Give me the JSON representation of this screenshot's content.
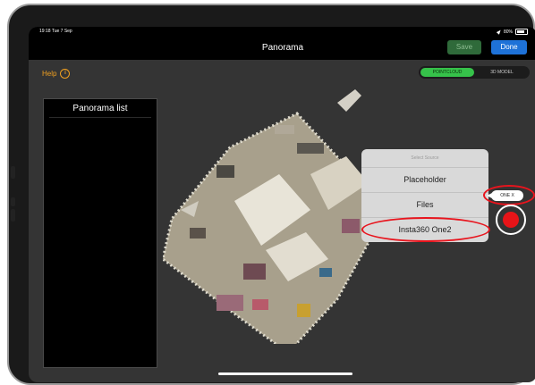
{
  "status_bar": {
    "time": "19:18",
    "date": "Tue 7 Sep",
    "battery": "80%",
    "location_icon": "location-arrow-icon",
    "battery_icon": "battery-icon"
  },
  "navbar": {
    "title": "Panorama",
    "save_label": "Save",
    "done_label": "Done"
  },
  "help": {
    "label": "Help",
    "icon": "info-icon"
  },
  "view_toggle": {
    "options": [
      "POINTCLOUD",
      "3D MODEL"
    ],
    "selected": "POINTCLOUD"
  },
  "panorama_list": {
    "title": "Panorama list",
    "items": []
  },
  "source_popup": {
    "header": "Select Source",
    "items": [
      "Placeholder",
      "Files",
      "Insta360 One2"
    ]
  },
  "camera": {
    "badge": "ONE X",
    "record_icon": "record-icon"
  },
  "colors": {
    "accent_blue": "#1e72d8",
    "accent_green": "#36c24a",
    "help_orange": "#f0a020",
    "highlight_red": "#e8141d"
  }
}
